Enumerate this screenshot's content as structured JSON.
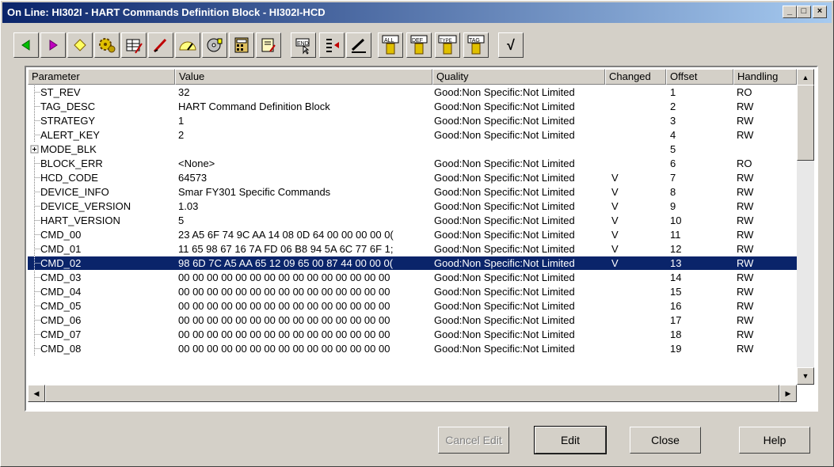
{
  "window": {
    "title": "On Line: HI302I - HART Commands Definition Block - HI302I-HCD"
  },
  "toolbar": {
    "icons": [
      "arrow-left-icon",
      "arrow-right-icon",
      "diamond-icon",
      "gears-icon",
      "table-edit-icon",
      "pen-icon",
      "gauge-icon",
      "disk-icon",
      "calculator-icon",
      "scroll-icon",
      "end-cursor-icon",
      "list-arrow-icon",
      "pencil-edit-icon",
      "filter-all-icon",
      "filter-def-icon",
      "filter-type-icon",
      "filter-tag-icon",
      "checkmark-icon"
    ],
    "labels": {
      "end": "END",
      "all": "ALL",
      "def": "DEF",
      "type": "TYPE",
      "tag": "TAG",
      "check": "√"
    }
  },
  "grid": {
    "columns": [
      "Parameter",
      "Value",
      "Quality",
      "Changed",
      "Offset",
      "Handling"
    ],
    "rows": [
      {
        "param": "ST_REV",
        "value": "32",
        "quality": "Good:Non Specific:Not Limited",
        "changed": "",
        "offset": "1",
        "handling": "RO"
      },
      {
        "param": "TAG_DESC",
        "value": "HART Command Definition Block",
        "quality": "Good:Non Specific:Not Limited",
        "changed": "",
        "offset": "2",
        "handling": "RW"
      },
      {
        "param": "STRATEGY",
        "value": "1",
        "quality": "Good:Non Specific:Not Limited",
        "changed": "",
        "offset": "3",
        "handling": "RW"
      },
      {
        "param": "ALERT_KEY",
        "value": "2",
        "quality": "Good:Non Specific:Not Limited",
        "changed": "",
        "offset": "4",
        "handling": "RW"
      },
      {
        "param": "MODE_BLK",
        "value": "",
        "quality": "",
        "changed": "",
        "offset": "5",
        "handling": "",
        "expand": true
      },
      {
        "param": "BLOCK_ERR",
        "value": "<None>",
        "quality": "Good:Non Specific:Not Limited",
        "changed": "",
        "offset": "6",
        "handling": "RO"
      },
      {
        "param": "HCD_CODE",
        "value": "64573",
        "quality": "Good:Non Specific:Not Limited",
        "changed": "V",
        "offset": "7",
        "handling": "RW"
      },
      {
        "param": "DEVICE_INFO",
        "value": "Smar FY301 Specific Commands",
        "quality": "Good:Non Specific:Not Limited",
        "changed": "V",
        "offset": "8",
        "handling": "RW"
      },
      {
        "param": "DEVICE_VERSION",
        "value": "1.03",
        "quality": "Good:Non Specific:Not Limited",
        "changed": "V",
        "offset": "9",
        "handling": "RW"
      },
      {
        "param": "HART_VERSION",
        "value": "5",
        "quality": "Good:Non Specific:Not Limited",
        "changed": "V",
        "offset": "10",
        "handling": "RW"
      },
      {
        "param": "CMD_00",
        "value": "23 A5 6F 74 9C AA 14 08 0D 64 00 00 00 00 0(",
        "quality": "Good:Non Specific:Not Limited",
        "changed": "V",
        "offset": "11",
        "handling": "RW"
      },
      {
        "param": "CMD_01",
        "value": "11 65 98 67 16 7A FD 06 B8 94 5A 6C 77 6F 1;",
        "quality": "Good:Non Specific:Not Limited",
        "changed": "V",
        "offset": "12",
        "handling": "RW"
      },
      {
        "param": "CMD_02",
        "value": "98 6D 7C A5 AA 65 12 09 65 00 87 44 00 00 0(",
        "quality": "Good:Non Specific:Not Limited",
        "changed": "V",
        "offset": "13",
        "handling": "RW",
        "selected": true
      },
      {
        "param": "CMD_03",
        "value": "00 00 00 00 00 00 00 00 00 00 00 00 00 00 00",
        "quality": "Good:Non Specific:Not Limited",
        "changed": "",
        "offset": "14",
        "handling": "RW"
      },
      {
        "param": "CMD_04",
        "value": "00 00 00 00 00 00 00 00 00 00 00 00 00 00 00",
        "quality": "Good:Non Specific:Not Limited",
        "changed": "",
        "offset": "15",
        "handling": "RW"
      },
      {
        "param": "CMD_05",
        "value": "00 00 00 00 00 00 00 00 00 00 00 00 00 00 00",
        "quality": "Good:Non Specific:Not Limited",
        "changed": "",
        "offset": "16",
        "handling": "RW"
      },
      {
        "param": "CMD_06",
        "value": "00 00 00 00 00 00 00 00 00 00 00 00 00 00 00",
        "quality": "Good:Non Specific:Not Limited",
        "changed": "",
        "offset": "17",
        "handling": "RW"
      },
      {
        "param": "CMD_07",
        "value": "00 00 00 00 00 00 00 00 00 00 00 00 00 00 00",
        "quality": "Good:Non Specific:Not Limited",
        "changed": "",
        "offset": "18",
        "handling": "RW"
      },
      {
        "param": "CMD_08",
        "value": "00 00 00 00 00 00 00 00 00 00 00 00 00 00 00",
        "quality": "Good:Non Specific:Not Limited",
        "changed": "",
        "offset": "19",
        "handling": "RW"
      }
    ]
  },
  "buttons": {
    "cancel_edit": "Cancel Edit",
    "edit": "Edit",
    "close": "Close",
    "help": "Help"
  },
  "colors": {
    "titlebar": "#0a246a",
    "selection": "#0a246a",
    "face": "#d4d0c8"
  }
}
